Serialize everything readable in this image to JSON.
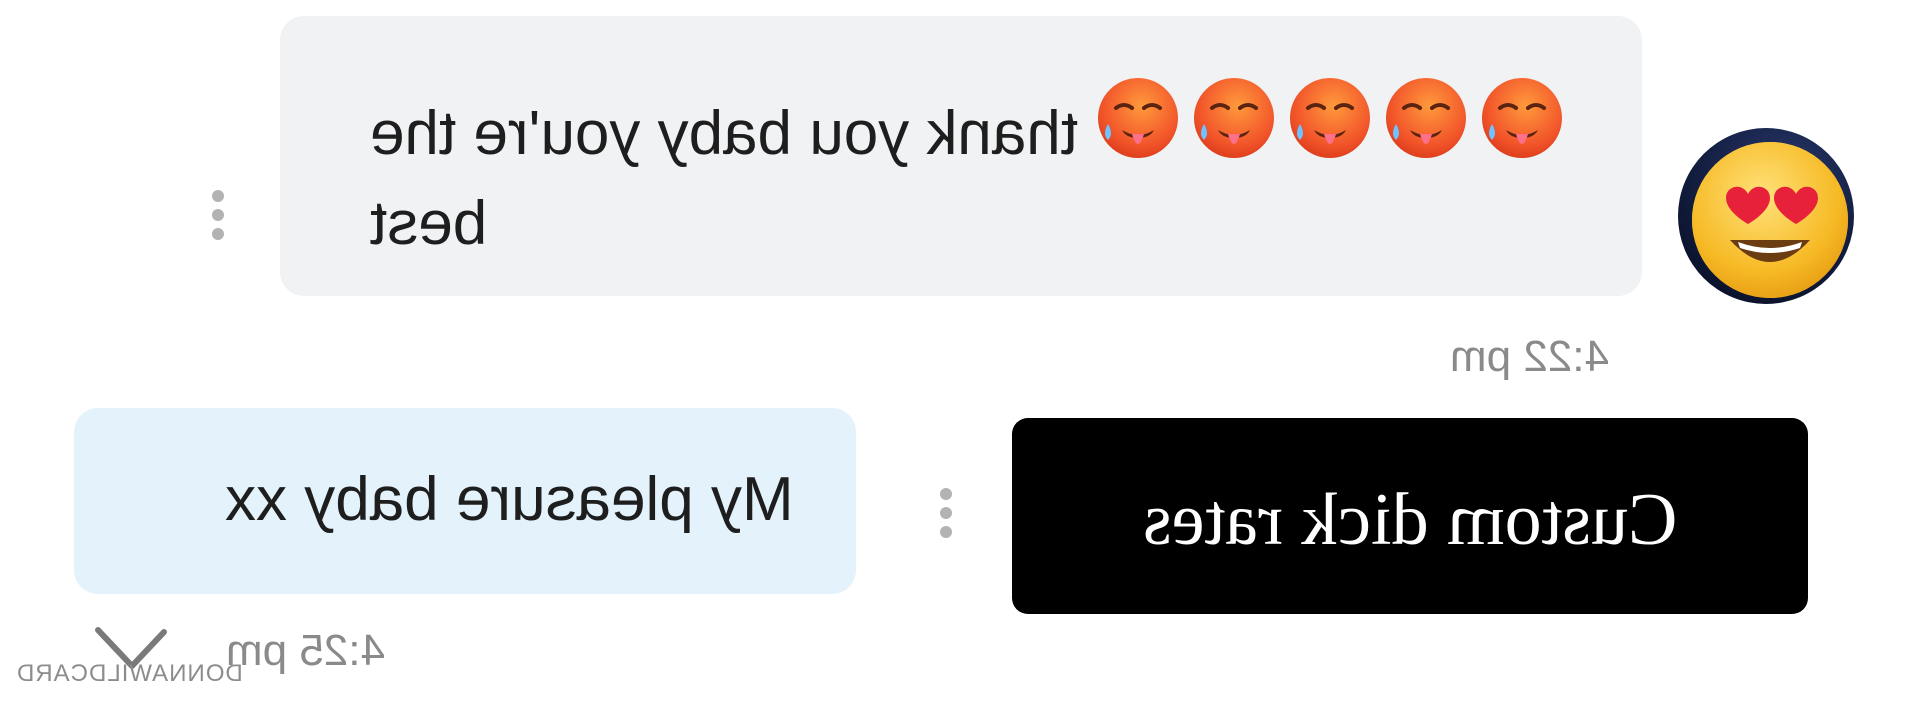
{
  "messages": {
    "received": {
      "text": "thank you baby you're the best",
      "emoji": [
        "hot-face-icon",
        "hot-face-icon",
        "hot-face-icon",
        "hot-face-icon",
        "hot-face-icon"
      ],
      "time": "4:22 pm"
    },
    "sent": {
      "text": "My pleasure baby xx",
      "time": "4:25 pm"
    },
    "image_message": {
      "text": "Custom dick rates"
    }
  },
  "watermark": "DONNAWILDCARD",
  "colors": {
    "received_bubble": "#f0f2f4",
    "sent_bubble": "#e3f2fb",
    "image_bg": "#000000",
    "timestamp": "#8a8a8a"
  },
  "icons": {
    "avatar": "heart-eyes-emoji-icon",
    "more_options": "more-vertical-icon",
    "read_status": "checkmark-icon"
  }
}
